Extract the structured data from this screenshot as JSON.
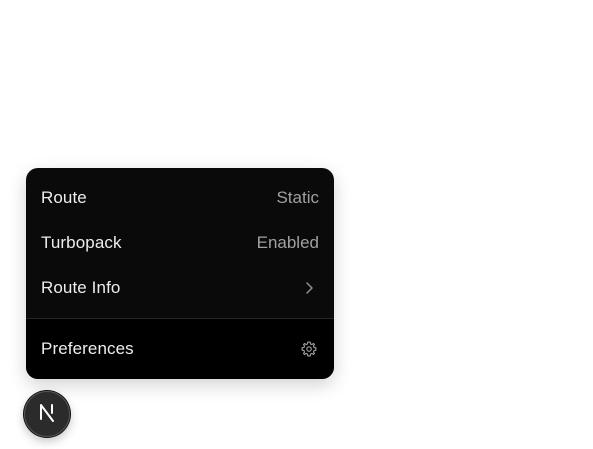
{
  "menu": {
    "rows": [
      {
        "label": "Route",
        "value": "Static"
      },
      {
        "label": "Turbopack",
        "value": "Enabled"
      },
      {
        "label": "Route Info",
        "icon": "chevron-right-icon"
      }
    ],
    "footer": {
      "label": "Preferences",
      "icon": "gear-icon"
    }
  },
  "badge": {
    "icon": "nextjs-logo-icon"
  },
  "colors": {
    "menu_bg": "#0a0a0a",
    "footer_bg": "#000000",
    "label": "#ededed",
    "value": "#a1a1a1",
    "divider": "#262626",
    "badge_bg": "#2b2b2b"
  }
}
